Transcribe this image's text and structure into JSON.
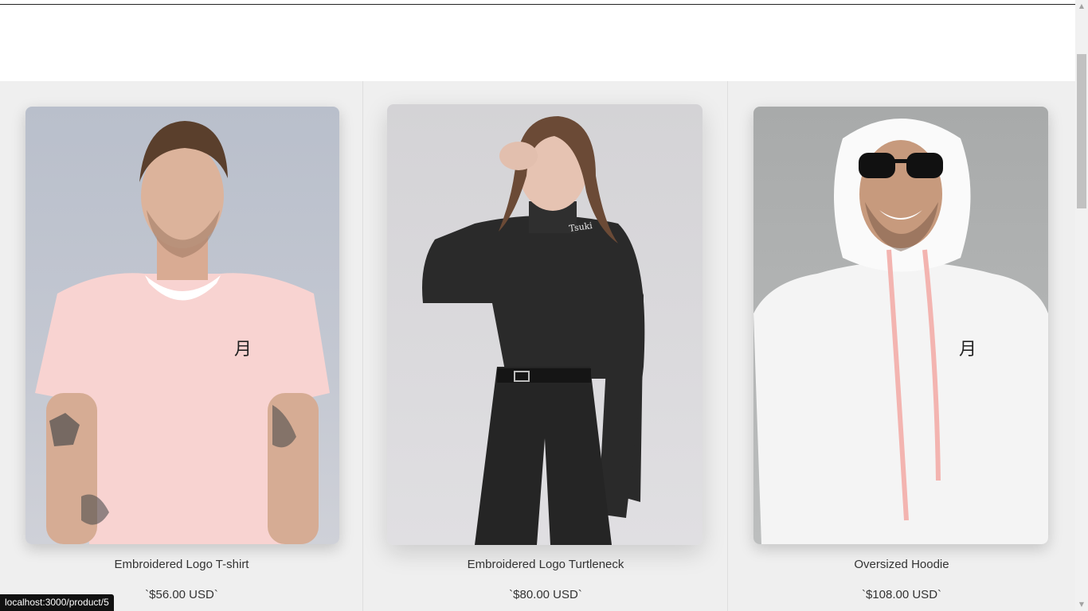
{
  "products": [
    {
      "name": "Embroidered Logo T-shirt",
      "price": "`$56.00 USD`",
      "image_icon": "photo-man-pink-tshirt"
    },
    {
      "name": "Embroidered Logo Turtleneck",
      "price": "`$80.00 USD`",
      "image_icon": "photo-woman-black-turtleneck"
    },
    {
      "name": "Oversized Hoodie",
      "price": "`$108.00 USD`",
      "image_icon": "photo-man-white-hoodie"
    }
  ],
  "status_bar": {
    "url": "localhost:3000/product/5"
  },
  "colors": {
    "grid_background": "#efefef",
    "text": "#333333",
    "status_bar_bg": "#111111"
  }
}
